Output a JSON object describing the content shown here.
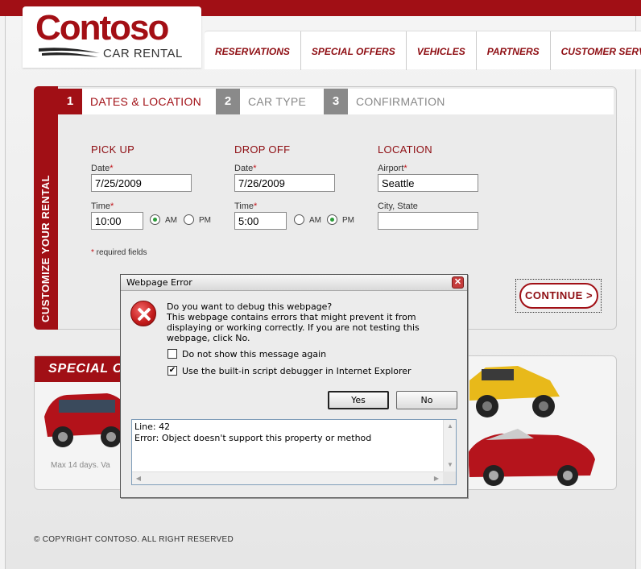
{
  "brand": {
    "name": "Contoso",
    "tagline": "CAR RENTAL"
  },
  "nav": [
    "RESERVATIONS",
    "SPECIAL OFFERS",
    "VEHICLES",
    "PARTNERS",
    "CUSTOMER SERVICE"
  ],
  "panel": {
    "vertical_label": "CUSTOMIZE YOUR RENTAL"
  },
  "steps": [
    {
      "num": "1",
      "label": "DATES & LOCATION"
    },
    {
      "num": "2",
      "label": "CAR TYPE"
    },
    {
      "num": "3",
      "label": "CONFIRMATION"
    }
  ],
  "pickup": {
    "heading": "PICK UP",
    "date_label": "Date",
    "date_value": "7/25/2009",
    "time_label": "Time",
    "time_value": "10:00",
    "am": "AM",
    "pm": "PM",
    "selected": "AM"
  },
  "dropoff": {
    "heading": "DROP OFF",
    "date_label": "Date",
    "date_value": "7/26/2009",
    "time_label": "Time",
    "time_value": "5:00",
    "am": "AM",
    "pm": "PM",
    "selected": "PM"
  },
  "location": {
    "heading": "LOCATION",
    "airport_label": "Airport",
    "airport_value": "Seattle",
    "city_label": "City, State",
    "city_value": ""
  },
  "required_note": "required fields",
  "continue_label": "CONTINUE >",
  "offers": {
    "title": "SPECIAL O",
    "fine_print": "Max 14 days. Va"
  },
  "footer": "© COPYRIGHT CONTOSO. ALL RIGHT RESERVED",
  "dialog": {
    "title": "Webpage Error",
    "question": "Do you want to debug this webpage?",
    "body": "This webpage contains errors that might prevent it from displaying or working correctly. If you are not testing this webpage, click No.",
    "check1": {
      "label": "Do not show this message again",
      "checked": false
    },
    "check2": {
      "label": "Use the built-in script debugger in Internet Explorer",
      "checked": true
    },
    "yes": "Yes",
    "no": "No",
    "details": "Line: 42\nError: Object doesn't support this property or method"
  },
  "colors": {
    "brand_red": "#a10f15",
    "dark_red": "#8e0d12"
  }
}
